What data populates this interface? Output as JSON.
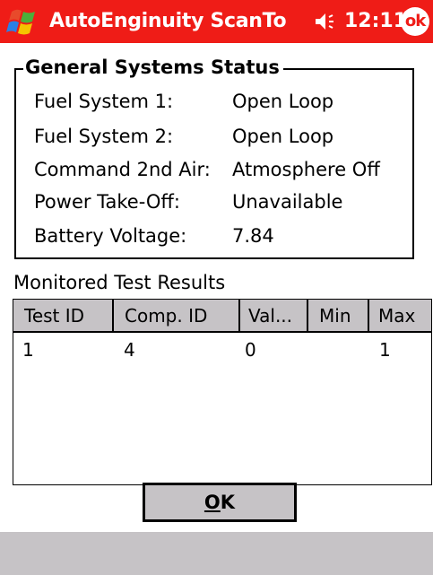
{
  "titlebar": {
    "app_title": "AutoEnginuity ScanTo",
    "clock": "12:11",
    "ok_label": "ok",
    "start_icon": "windows-flag-icon",
    "speaker_icon": "speaker-icon"
  },
  "colors": {
    "titlebar_bg": "#ef1c17",
    "header_bg": "#c6c3c6",
    "bottombar_bg": "#c6c3c6"
  },
  "status_group": {
    "title": "General Systems Status",
    "rows": [
      {
        "label": "Fuel System 1:",
        "value": "Open Loop"
      },
      {
        "label": "Fuel System 2:",
        "value": "Open Loop"
      },
      {
        "label": "Command 2nd Air:",
        "value": "Atmosphere Off"
      },
      {
        "label": "Power Take-Off:",
        "value": "Unavailable"
      },
      {
        "label": "Battery Voltage:",
        "value": "7.84"
      }
    ]
  },
  "monitored": {
    "label": "Monitored Test Results",
    "columns": [
      "Test ID",
      "Comp. ID",
      "Val...",
      "Min",
      "Max"
    ],
    "rows": [
      [
        "1",
        "4",
        "0",
        "",
        "1"
      ]
    ]
  },
  "ok_button": {
    "accel": "O",
    "rest": "K"
  }
}
